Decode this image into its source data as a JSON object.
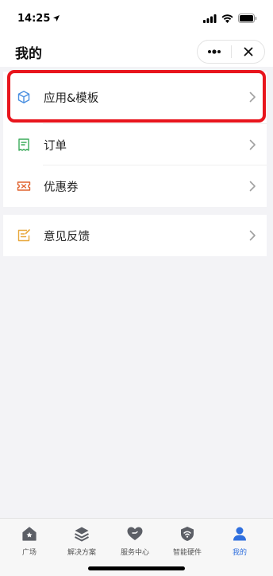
{
  "status": {
    "time": "14:25"
  },
  "nav": {
    "title": "我的"
  },
  "menu": {
    "items": [
      {
        "label": "应用&模板",
        "icon": "cube-icon",
        "color": "#4a8fe0"
      },
      {
        "label": "订单",
        "icon": "receipt-icon",
        "color": "#3bab5a"
      },
      {
        "label": "优惠券",
        "icon": "coupon-icon",
        "color": "#e0632f"
      }
    ],
    "feedback": {
      "label": "意见反馈",
      "icon": "edit-note-icon",
      "color": "#e8a73a"
    }
  },
  "tabs": [
    {
      "label": "广场",
      "icon": "home-star-icon"
    },
    {
      "label": "解决方案",
      "icon": "layers-icon"
    },
    {
      "label": "服务中心",
      "icon": "heart-hand-icon"
    },
    {
      "label": "智能硬件",
      "icon": "wifi-shield-icon"
    },
    {
      "label": "我的",
      "icon": "person-icon",
      "active": true
    }
  ],
  "colors": {
    "accent": "#2f6fde",
    "highlight": "#e8151d"
  }
}
